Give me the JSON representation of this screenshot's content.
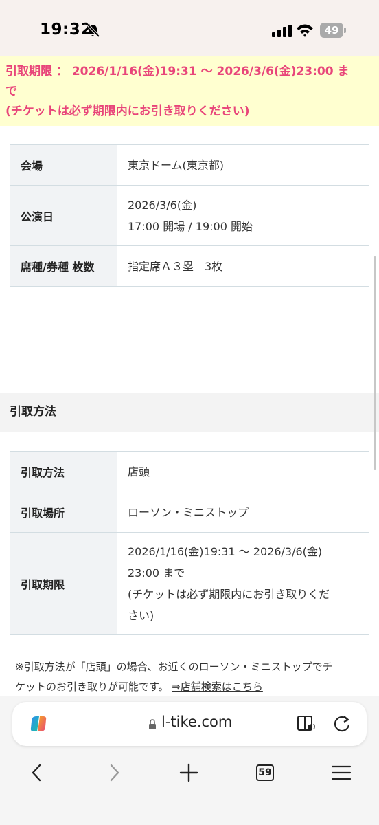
{
  "status_bar": {
    "time": "19:32",
    "battery": "49"
  },
  "notice": {
    "line1": "引取期限 ： 2026/1/16(金)19:31 〜 2026/3/6(金)23:00 ま",
    "line2": "で",
    "line3": "(チケットは必ず期限内にお引き取りください)",
    "color": "#e8457a"
  },
  "event_table": {
    "rows": [
      {
        "label": "会場",
        "lines": [
          "東京ドーム(東京都)"
        ]
      },
      {
        "label": "公演日",
        "lines": [
          "2026/3/6(金)",
          "17:00 開場 / 19:00 開始"
        ]
      },
      {
        "label": "席種/券種 枚数",
        "lines": [
          "指定席Ａ３塁　3枚"
        ]
      }
    ]
  },
  "section": {
    "title": "引取方法"
  },
  "pickup_table": {
    "rows": [
      {
        "label": "引取方法",
        "lines": [
          "店頭"
        ]
      },
      {
        "label": "引取場所",
        "lines": [
          "ローソン・ミニストップ"
        ]
      },
      {
        "label": "引取期限",
        "lines": [
          "2026/1/16(金)19:31 〜 2026/3/6(金)",
          "23:00 まで",
          "(チケットは必ず期限内にお引き取りくだ",
          "さい)"
        ]
      }
    ]
  },
  "footnote": {
    "line1": "※引取方法が「店頭」の場合、お近くのローソン・ミニストップでチ",
    "line2": "ケットのお引き取りが可能です。 ",
    "link": "⇒店舗検索はこちら"
  },
  "browser": {
    "url": "l-tike.com",
    "tab_count": "59"
  }
}
